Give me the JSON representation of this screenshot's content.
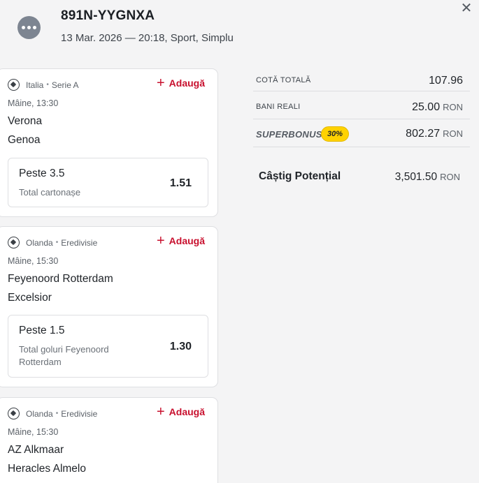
{
  "header": {
    "ticket_id": "891N-YYGNXA",
    "meta": "13 Mar. 2026 — 20:18, Sport, Simplu",
    "close_glyph": "✕"
  },
  "events": [
    {
      "country": "Italia",
      "league": "Serie A",
      "add_label": "Adaugă",
      "time": "Mâine, 13:30",
      "home": "Verona",
      "away": "Genoa",
      "pick": "Peste 3.5",
      "market": "Total cartonașe",
      "odd": "1.51"
    },
    {
      "country": "Olanda",
      "league": "Eredivisie",
      "add_label": "Adaugă",
      "time": "Mâine, 15:30",
      "home": "Feyenoord Rotterdam",
      "away": "Excelsior",
      "pick": "Peste 1.5",
      "market": "Total goluri Feyenoord Rotterdam",
      "odd": "1.30"
    },
    {
      "country": "Olanda",
      "league": "Eredivisie",
      "add_label": "Adaugă",
      "time": "Mâine, 15:30",
      "home": "AZ Alkmaar",
      "away": "Heracles Almelo"
    }
  ],
  "summary": {
    "total_odds_label": "COTĂ TOTALĂ",
    "total_odds_value": "107.96",
    "stake_label": "BANI REALI",
    "stake_value": "25.00",
    "stake_currency": "RON",
    "superbonus_label": "SUPERBONUS",
    "superbonus_badge": "30%",
    "superbonus_value": "802.27",
    "superbonus_currency": "RON",
    "potential_label": "Câștig Potențial",
    "potential_value": "3,501.50",
    "potential_currency": "RON"
  },
  "colors": {
    "accent_red": "#c8102e",
    "badge_yellow": "#ffd200",
    "background": "#f4f4f5"
  }
}
